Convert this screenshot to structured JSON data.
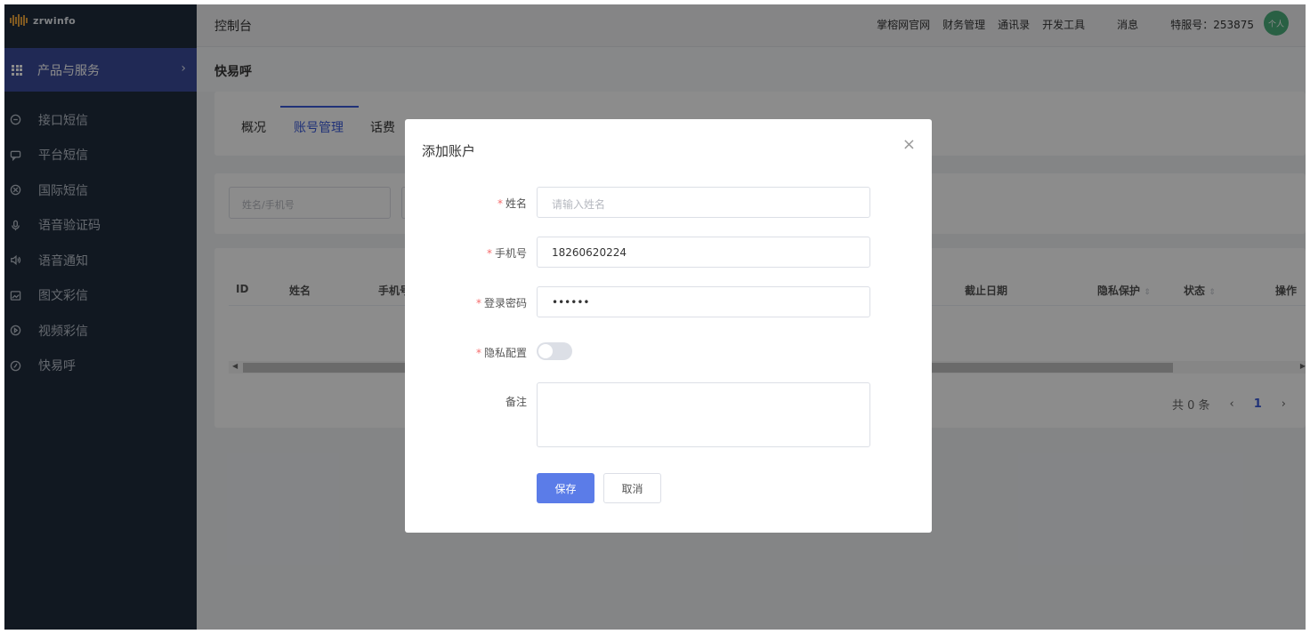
{
  "brand": {
    "logo_text": "zrwinfo"
  },
  "sidebar": {
    "product_label": "产品与服务",
    "items": [
      {
        "label": "接口短信",
        "icon": "message-circle-icon"
      },
      {
        "label": "平台短信",
        "icon": "chat-bubble-icon"
      },
      {
        "label": "国际短信",
        "icon": "globe-icon"
      },
      {
        "label": "语音验证码",
        "icon": "microphone-icon"
      },
      {
        "label": "语音通知",
        "icon": "speaker-icon"
      },
      {
        "label": "图文彩信",
        "icon": "image-icon"
      },
      {
        "label": "视频彩信",
        "icon": "play-circle-icon"
      },
      {
        "label": "快易呼",
        "icon": "phone-circle-icon"
      }
    ]
  },
  "header": {
    "title": "控制台",
    "links": [
      "掌榕网官网",
      "财务管理",
      "通讯录",
      "开发工具"
    ],
    "messages": "消息",
    "service_no": "特服号：253875",
    "avatar": "个人"
  },
  "page": {
    "subtitle": "快易呼"
  },
  "tabs": [
    "概况",
    "账号管理",
    "话费"
  ],
  "filters": {
    "name_phone_placeholder": "姓名/手机号"
  },
  "table": {
    "columns": [
      "ID",
      "姓名",
      "手机号",
      "截止日期",
      "隐私保护",
      "状态",
      "操作"
    ],
    "sort_glyph": "⇕",
    "total": "共 0 条",
    "current_page": "1",
    "prev": "‹",
    "next": "›"
  },
  "modal": {
    "title": "添加账户",
    "close": "×",
    "fields": {
      "name_label": "姓名",
      "name_placeholder": "请输入姓名",
      "phone_label": "手机号",
      "phone_value": "18260620224",
      "password_label": "登录密码",
      "password_value": "••••••",
      "privacy_label": "隐私配置",
      "privacy_enabled": false,
      "remark_label": "备注"
    },
    "save_label": "保存",
    "cancel_label": "取消"
  }
}
